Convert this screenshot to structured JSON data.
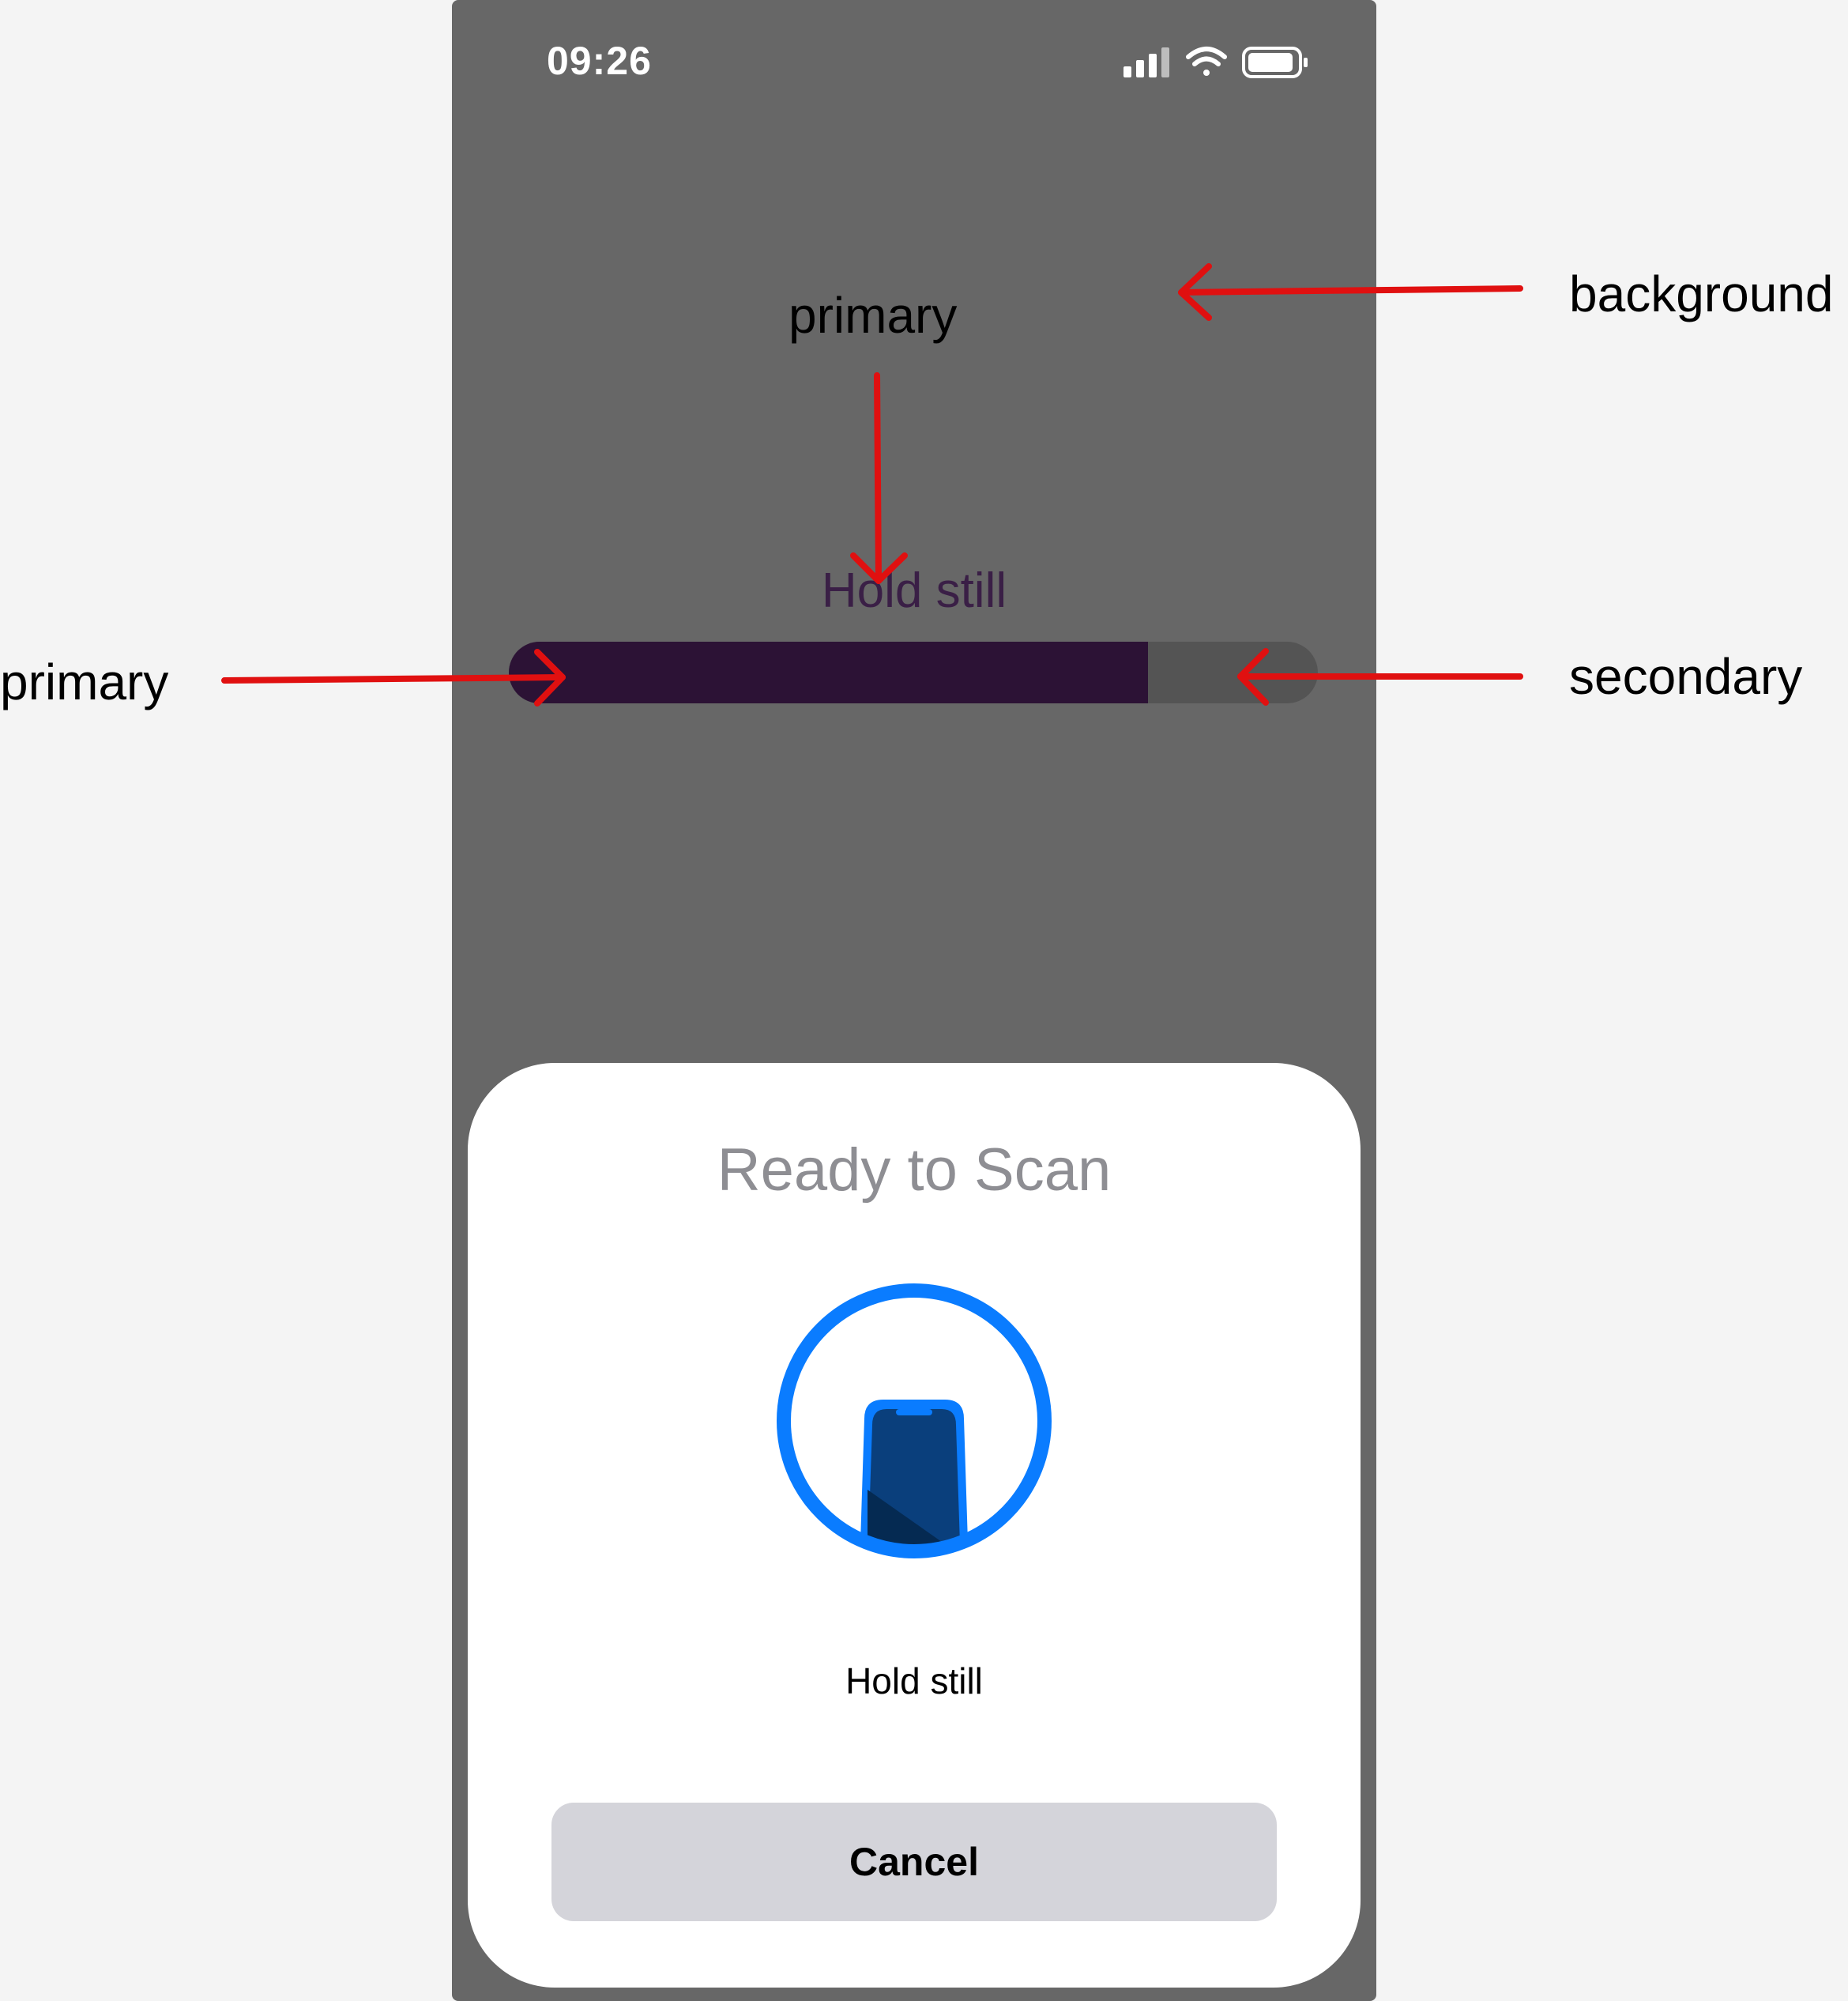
{
  "status_bar": {
    "time": "09:26"
  },
  "main": {
    "hold_label": "Hold still",
    "progress_fraction": 0.79
  },
  "sheet": {
    "title": "Ready to Scan",
    "message": "Hold still",
    "cancel_label": "Cancel"
  },
  "annotations": {
    "background": "background",
    "primary_text": "primary",
    "primary_bar": "primary",
    "secondary_bar": "secondary"
  },
  "colors": {
    "background": "#676767",
    "primary": "#2c1235",
    "secondary": "#545454",
    "accent": "#0a7cff",
    "arrow": "#e01010"
  }
}
